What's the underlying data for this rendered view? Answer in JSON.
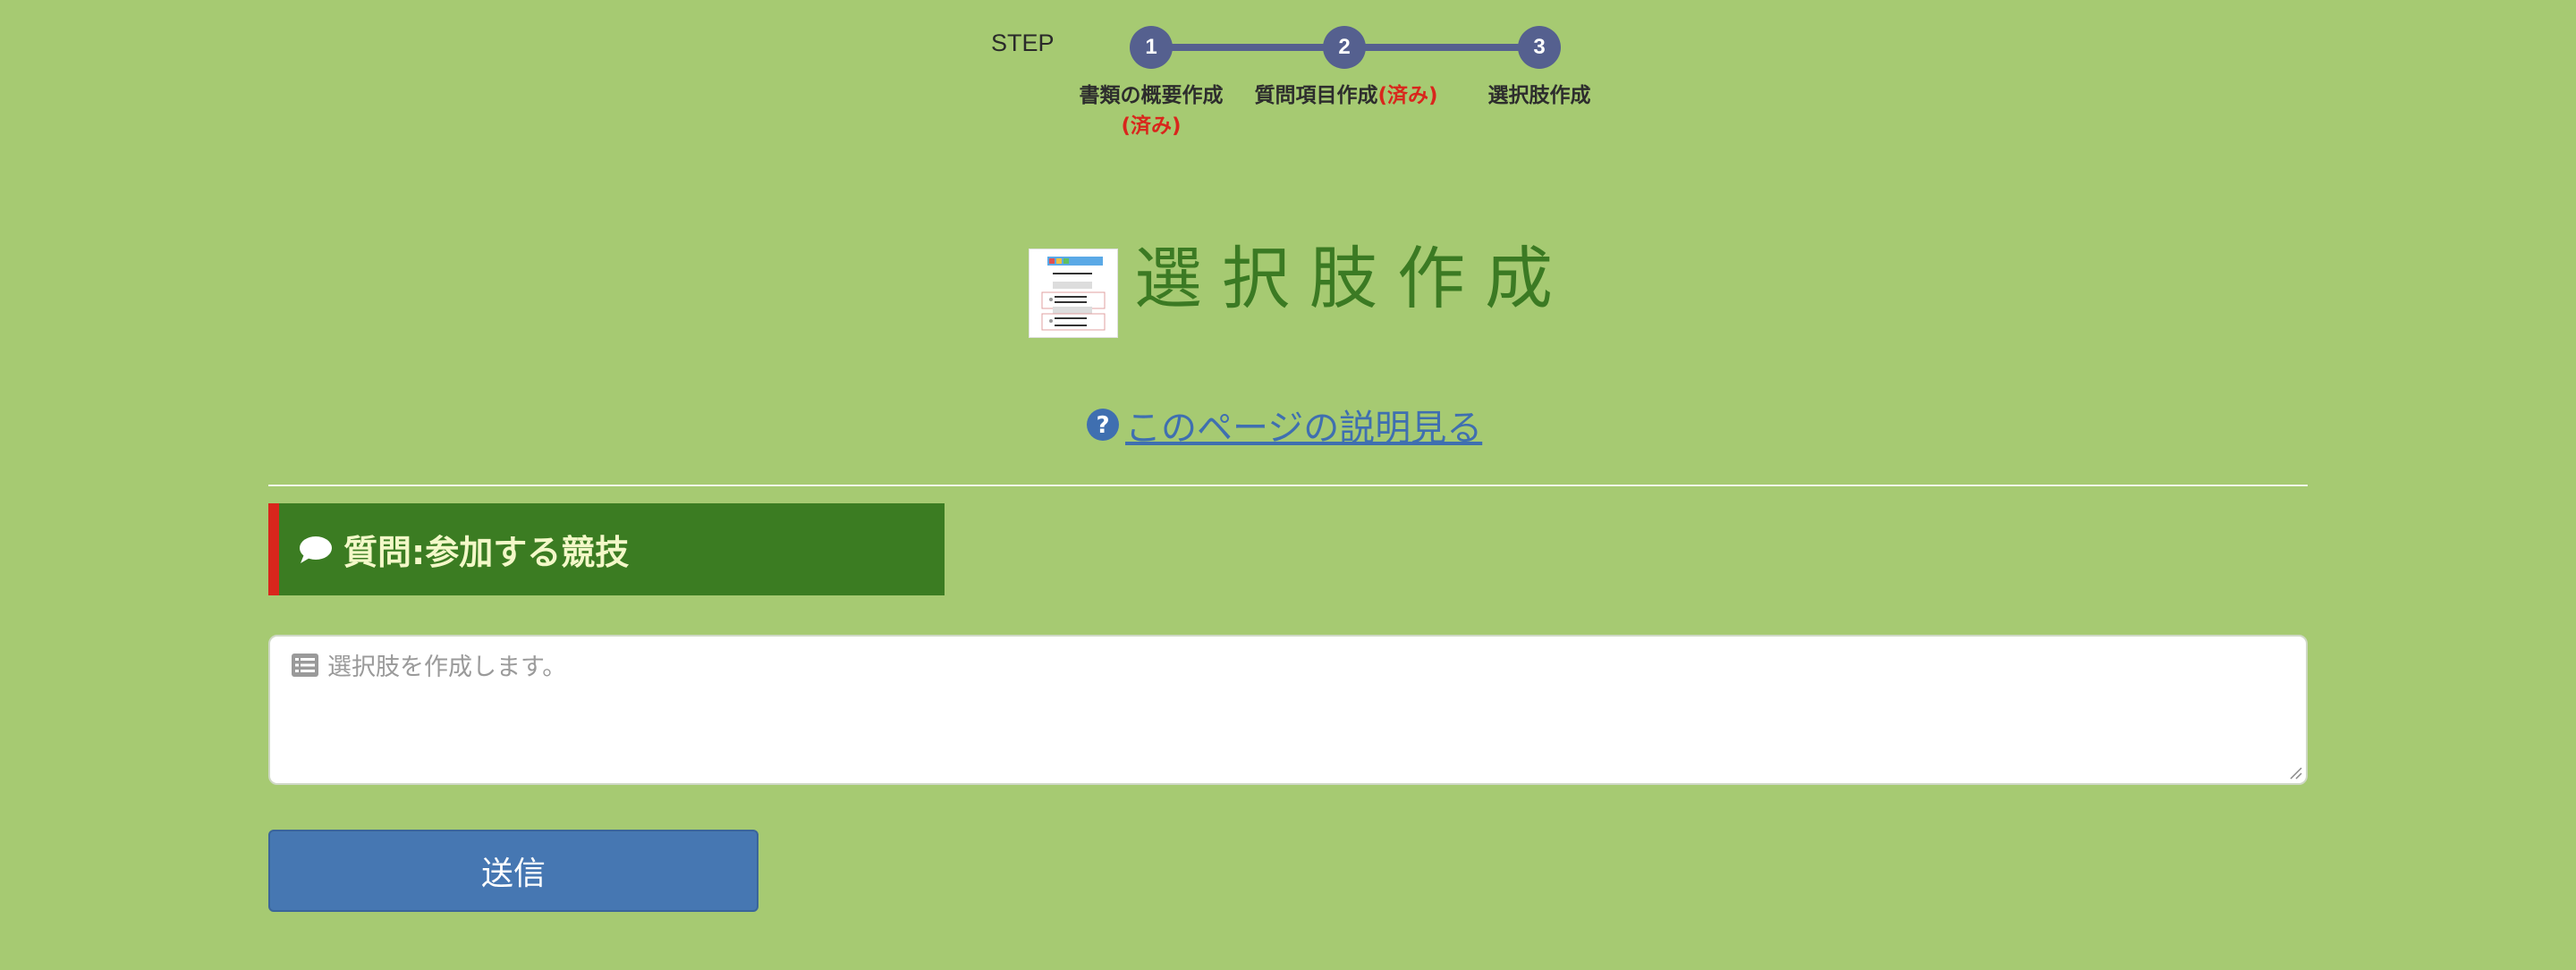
{
  "steps": {
    "label": "STEP",
    "items": [
      {
        "number": "1",
        "caption": "書類の概要作成",
        "status": "(済み)"
      },
      {
        "number": "2",
        "caption": "質問項目作成",
        "status": "(済み)"
      },
      {
        "number": "3",
        "caption": "選択肢作成",
        "status": ""
      }
    ],
    "line_color": "#55608f",
    "done_color": "#d9261c"
  },
  "page": {
    "title": "選択肢作成",
    "title_icon": "form-thumbnail-icon",
    "help_link": "このページの説明見る",
    "help_icon": "question-circle-icon"
  },
  "question": {
    "label": "質問:参加する競技",
    "icon": "speech-bubble-icon",
    "accent_color": "#d9261c",
    "background_color": "#3b7c22"
  },
  "choices_input": {
    "placeholder": "選択肢を作成します。",
    "value": "",
    "icon": "list-icon"
  },
  "submit": {
    "label": "送信",
    "color": "#4677b2"
  },
  "colors": {
    "background": "#a6ca72",
    "title": "#3b7a23",
    "link": "#3f6fb0"
  }
}
